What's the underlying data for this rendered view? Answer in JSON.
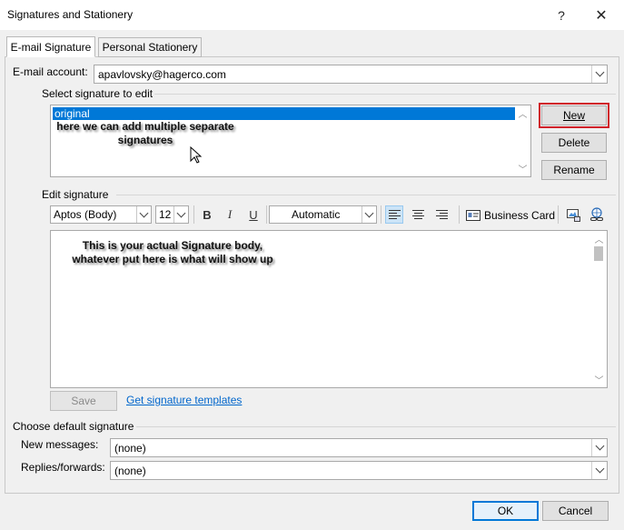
{
  "window": {
    "title": "Signatures and Stationery",
    "help_glyph": "?",
    "close_glyph": "✕"
  },
  "tabs": [
    {
      "label": "E-mail Signature",
      "active": true
    },
    {
      "label": "Personal Stationery",
      "active": false
    }
  ],
  "account": {
    "label": "E-mail account:",
    "value": "apavlovsky@hagerco.com"
  },
  "select_signature": {
    "label": "Select signature to edit",
    "items": [
      "original"
    ],
    "selected": "original",
    "annotation": "here we can add multiple separate signatures"
  },
  "signature_buttons": {
    "new": "New",
    "delete": "Delete",
    "rename": "Rename"
  },
  "edit_signature": {
    "label": "Edit signature",
    "font": "Aptos (Body)",
    "size": "12",
    "bold": "B",
    "italic": "I",
    "underline": "U",
    "color": "Automatic",
    "business_card": "Business Card",
    "body_text": "This is your actual Signature body, whatever put here is what will show up"
  },
  "actions": {
    "save": "Save",
    "templates_link": "Get signature templates"
  },
  "default_signature": {
    "label": "Choose default signature",
    "new_messages_label": "New messages:",
    "new_messages_value": "(none)",
    "replies_label": "Replies/forwards:",
    "replies_value": "(none)"
  },
  "footer": {
    "ok": "OK",
    "cancel": "Cancel"
  },
  "colors": {
    "selection": "#0078d7",
    "highlight_outline": "#d0202a",
    "link": "#0066cc"
  }
}
